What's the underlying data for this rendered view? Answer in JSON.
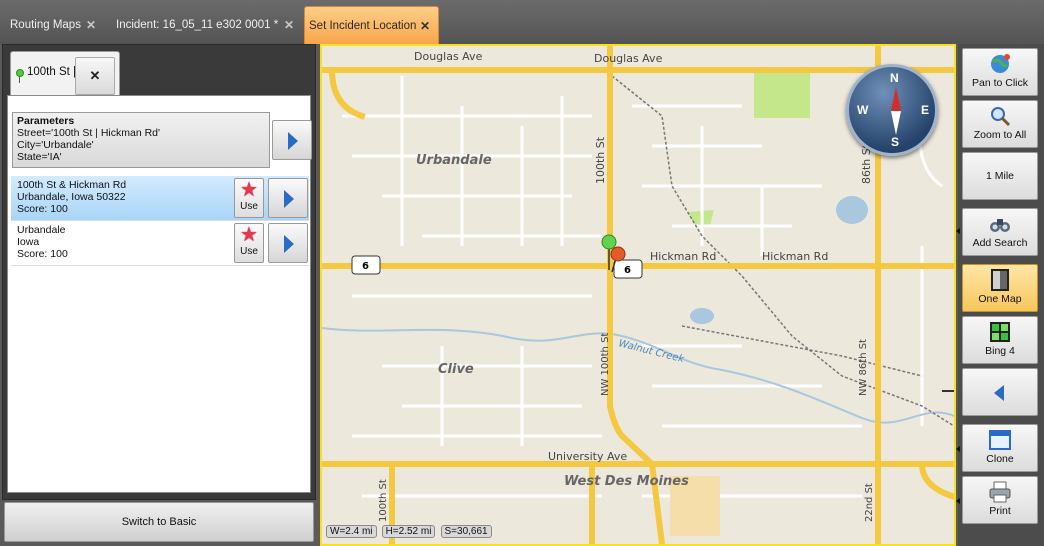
{
  "tabs": [
    {
      "label": "Routing Maps"
    },
    {
      "label": "Incident: 16_05_11 e302 0001 *"
    },
    {
      "label": "Set Incident Location"
    }
  ],
  "left_panel": {
    "tab_label": "100th St |",
    "parameters": {
      "header": "Parameters",
      "street": "Street='100th St | Hickman Rd'",
      "city": "City='Urbandale'",
      "state": "State='IA'"
    },
    "results": [
      {
        "line1": "100th St & Hickman Rd",
        "line2": "Urbandale, Iowa  50322",
        "score": "Score:  100",
        "use_label": "Use"
      },
      {
        "line1": "Urbandale",
        "line2": "Iowa",
        "score": "Score:  100",
        "use_label": "Use"
      }
    ],
    "switch_label": "Switch to Basic"
  },
  "map": {
    "labels": {
      "douglas_west": "Douglas Ave",
      "douglas_east": "Douglas Ave",
      "street_100th_north": "100th St",
      "street_86th_north": "86th St",
      "urbandale": "Urbandale",
      "hickman_1": "Hickman Rd",
      "hickman_2": "Hickman Rd",
      "shield_west": "6",
      "shield_east": "6",
      "nw100th": "NW 100th St",
      "walnut_creek": "Walnut Creek",
      "clive": "Clive",
      "nw86th": "NW 86th St",
      "university": "University Ave",
      "west_des_moines": "West Des Moines",
      "street_100th_south": "100th St",
      "street_22nd": "22nd St"
    },
    "compass": {
      "n": "N",
      "s": "S",
      "e": "E",
      "w": "W"
    },
    "status": {
      "width": "W=2.4 mi",
      "height": "H=2.52 mi",
      "scale": "S=30,661"
    },
    "colors": {
      "major_road": "#f5c842",
      "minor_road": "#ffffff",
      "background": "#ece8dc",
      "park": "#c5e78c",
      "water": "#a9c7df",
      "border": "#f5e21b"
    }
  },
  "toolbar": {
    "pan": "Pan to Click",
    "zoom_all": "Zoom to All",
    "scale": "1 Mile",
    "add_search": "Add Search",
    "one_map": "One Map",
    "bing4": "Bing 4",
    "clone": "Clone",
    "print": "Print"
  },
  "colors": {
    "active_tab": "#f7a648",
    "selection": "#a9d5f7",
    "accent_blue": "#2a6bc4"
  }
}
